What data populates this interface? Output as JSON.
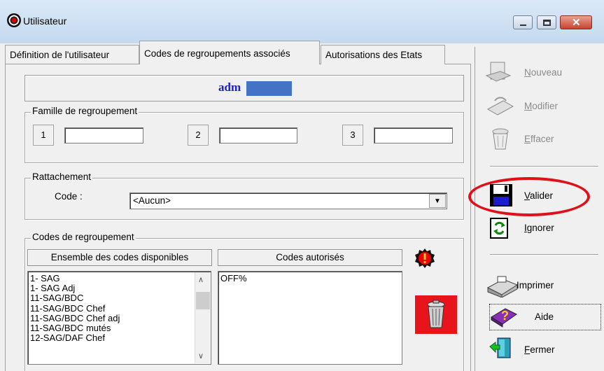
{
  "window": {
    "title": "Utilisateur"
  },
  "tabs": [
    {
      "label": "Définition de l'utilisateur"
    },
    {
      "label": "Codes de regroupements associés"
    },
    {
      "label": "Autorisations des Etats"
    }
  ],
  "header": {
    "user": "adm"
  },
  "famille": {
    "legend": "Famille de regroupement",
    "fields": [
      {
        "number": "1",
        "value": ""
      },
      {
        "number": "2",
        "value": ""
      },
      {
        "number": "3",
        "value": ""
      }
    ]
  },
  "rattachement": {
    "legend": "Rattachement",
    "code_label": "Code :",
    "selected": "<Aucun>"
  },
  "codes": {
    "legend": "Codes de regroupement",
    "available_header": "Ensemble des codes disponibles",
    "authorized_header": "Codes autorisés",
    "available": [
      "1- SAG",
      "1- SAG Adj",
      "11-SAG/BDC",
      "11-SAG/BDC Chef",
      "11-SAG/BDC Chef adj",
      "11-SAG/BDC mutés",
      "12-SAG/DAF Chef"
    ],
    "authorized": [
      "OFF%"
    ]
  },
  "actions": {
    "nouveau": "Nouveau",
    "modifier": "Modifier",
    "effacer": "Effacer",
    "valider": "Valider",
    "ignorer": "Ignorer",
    "imprimer": "Imprimer",
    "aide": "Aide",
    "fermer": "Fermer"
  },
  "colors": {
    "highlight": "#4472c4",
    "annotation": "#e0101a",
    "user_text": "#1a22cc"
  }
}
